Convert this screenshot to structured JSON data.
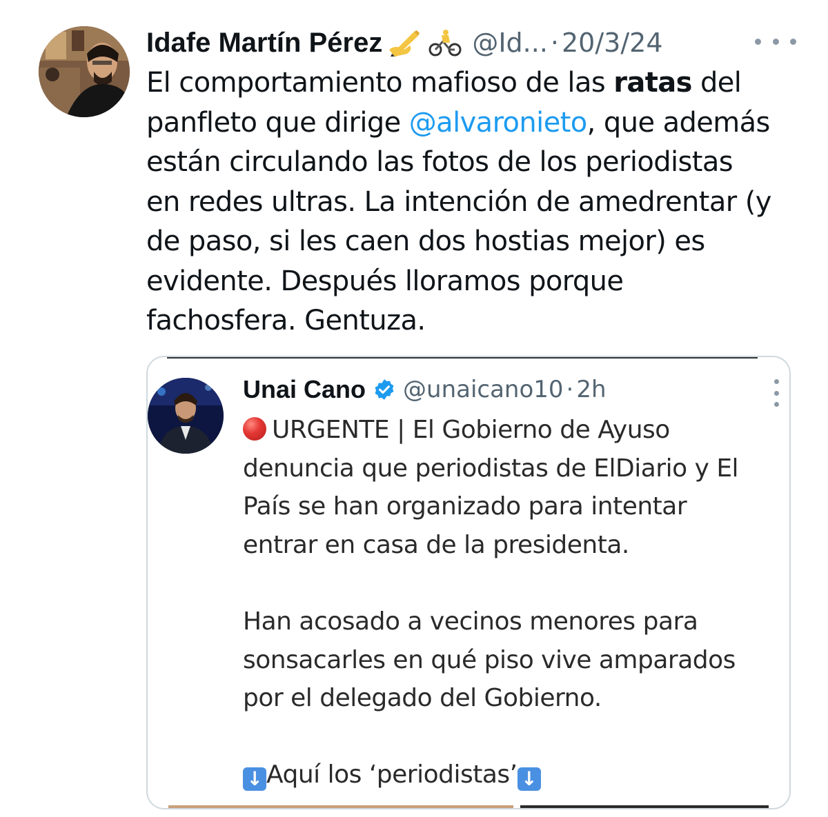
{
  "tweet": {
    "display_name": "Idafe Martín Pérez",
    "emoji_1": "writing-hand-emoji",
    "emoji_2": "cyclist-emoji",
    "handle": "@Id...",
    "separator": "·",
    "date": "20/3/24",
    "more_icon": "more-horizontal-icon",
    "text_segments": {
      "l1a": "El comportamiento mafioso de las ",
      "l1b": "ratas",
      "l1c": " del",
      "l2a": "panfleto que dirige ",
      "l2b": "@alvaronieto",
      "l2c": ", que además",
      "l3": "están circulando las fotos de los periodistas",
      "l4": "en redes ultras. La intención de amedrentar (y",
      "l5": "de paso, si les caen dos hostias mejor) es",
      "l6": "evidente. Después lloramos porque",
      "l7": "fachosfera. Gentuza."
    },
    "mention_color": "#1d9bf0"
  },
  "quote": {
    "display_name": "Unai Cano",
    "verified_icon": "verified-badge-icon",
    "handle": "@unaicano10",
    "separator": "·",
    "time": "2h",
    "more_icon": "more-vertical-icon",
    "lines": {
      "l1": "URGENTE | El Gobierno de Ayuso",
      "l2": "denuncia que periodistas de ElDiario y El",
      "l3": "País se han organizado para intentar",
      "l4": "entrar en casa de la presidenta.",
      "l5": "Han acosado a vecinos menores para",
      "l6": "sonsacarles en qué piso vive amparados",
      "l7": "por el delegado del Gobierno.",
      "l8": "Aquí los ‘periodistas’"
    },
    "red_circle_icon": "red-circle-emoji",
    "down_arrow_icon": "down-arrow-emoji",
    "arrow_glyph": "↓"
  }
}
